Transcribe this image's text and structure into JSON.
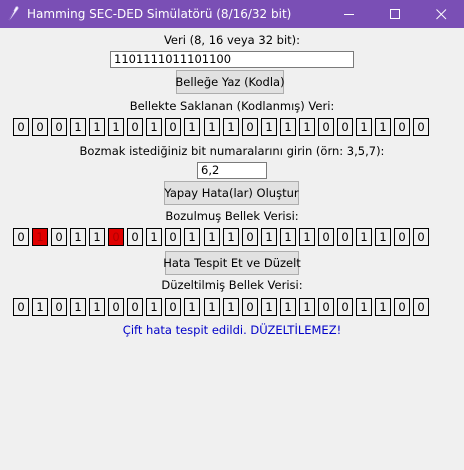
{
  "window": {
    "title": "Hamming SEC-DED Simülatörü (8/16/32 bit)",
    "controls": [
      "minimize-icon",
      "maximize-icon",
      "close-icon"
    ]
  },
  "input_section": {
    "label": "Veri (8, 16 veya 32 bit):",
    "value": "1101111011101100",
    "button": "Belleğe Yaz (Kodla)"
  },
  "stored": {
    "label": "Bellekte Saklanan (Kodlanmış) Veri:",
    "bits": [
      "0",
      "0",
      "0",
      "1",
      "1",
      "1",
      "0",
      "1",
      "0",
      "1",
      "1",
      "1",
      "0",
      "1",
      "1",
      "1",
      "0",
      "0",
      "1",
      "1",
      "0",
      "0"
    ]
  },
  "corrupt_section": {
    "label": "Bozmak istediğiniz bit numaralarını girin (örn: 3,5,7):",
    "value": "6,2",
    "button": "Yapay Hata(lar) Oluştur"
  },
  "corrupted": {
    "label": "Bozulmuş Bellek Verisi:",
    "bits": [
      "0",
      "1",
      "0",
      "1",
      "1",
      "0",
      "0",
      "1",
      "0",
      "1",
      "1",
      "1",
      "0",
      "1",
      "1",
      "1",
      "0",
      "0",
      "1",
      "1",
      "0",
      "0"
    ],
    "error_indices": [
      1,
      5
    ],
    "error_color": "#e00000"
  },
  "detect_button": "Hata Tespit Et ve Düzelt",
  "corrected": {
    "label": "Düzeltilmiş Bellek Verisi:",
    "bits": [
      "0",
      "1",
      "0",
      "1",
      "1",
      "0",
      "0",
      "1",
      "0",
      "1",
      "1",
      "1",
      "0",
      "1",
      "1",
      "1",
      "0",
      "0",
      "1",
      "1",
      "0",
      "0"
    ]
  },
  "status": {
    "text": "Çift hata tespit edildi. DÜZELTİLEMEZ!",
    "color": "#0000c8"
  },
  "colors": {
    "titlebar": "#7a4fb5",
    "background": "#f0f0f0"
  }
}
